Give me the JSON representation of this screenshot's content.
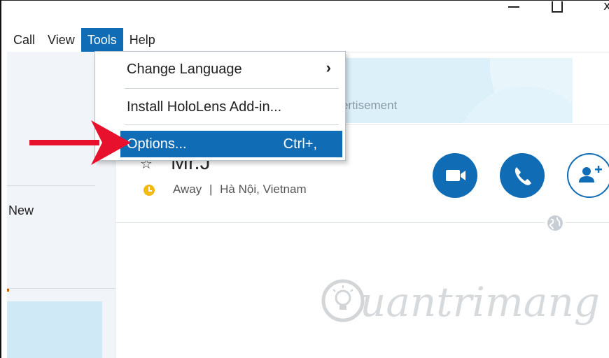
{
  "window": {
    "close_glyph": "x"
  },
  "menubar": {
    "items": [
      "Call",
      "View",
      "Tools",
      "Help"
    ],
    "active": "Tools"
  },
  "sidebar": {
    "new_label": "New"
  },
  "ad": {
    "label": "dvertisement"
  },
  "contact": {
    "name": "Mr.J",
    "status": "Away",
    "separator": "|",
    "location": "Hà Nội, Vietnam"
  },
  "tools_menu": {
    "items": [
      {
        "label": "Change Language",
        "submenu_indicator": "›"
      },
      {
        "label": "Install HoloLens Add-in..."
      },
      {
        "label": "Options...",
        "shortcut": "Ctrl+,",
        "highlighted": true
      }
    ]
  },
  "watermark": {
    "text": "uantrimang"
  },
  "colors": {
    "accent": "#0f6cb5",
    "arrow": "#e8112d",
    "away": "#f2b90f"
  },
  "icons": {
    "star": "star-icon",
    "away": "clock-icon",
    "video": "video-camera-icon",
    "audio": "phone-icon",
    "add": "add-person-icon",
    "globe": "globe-icon"
  }
}
